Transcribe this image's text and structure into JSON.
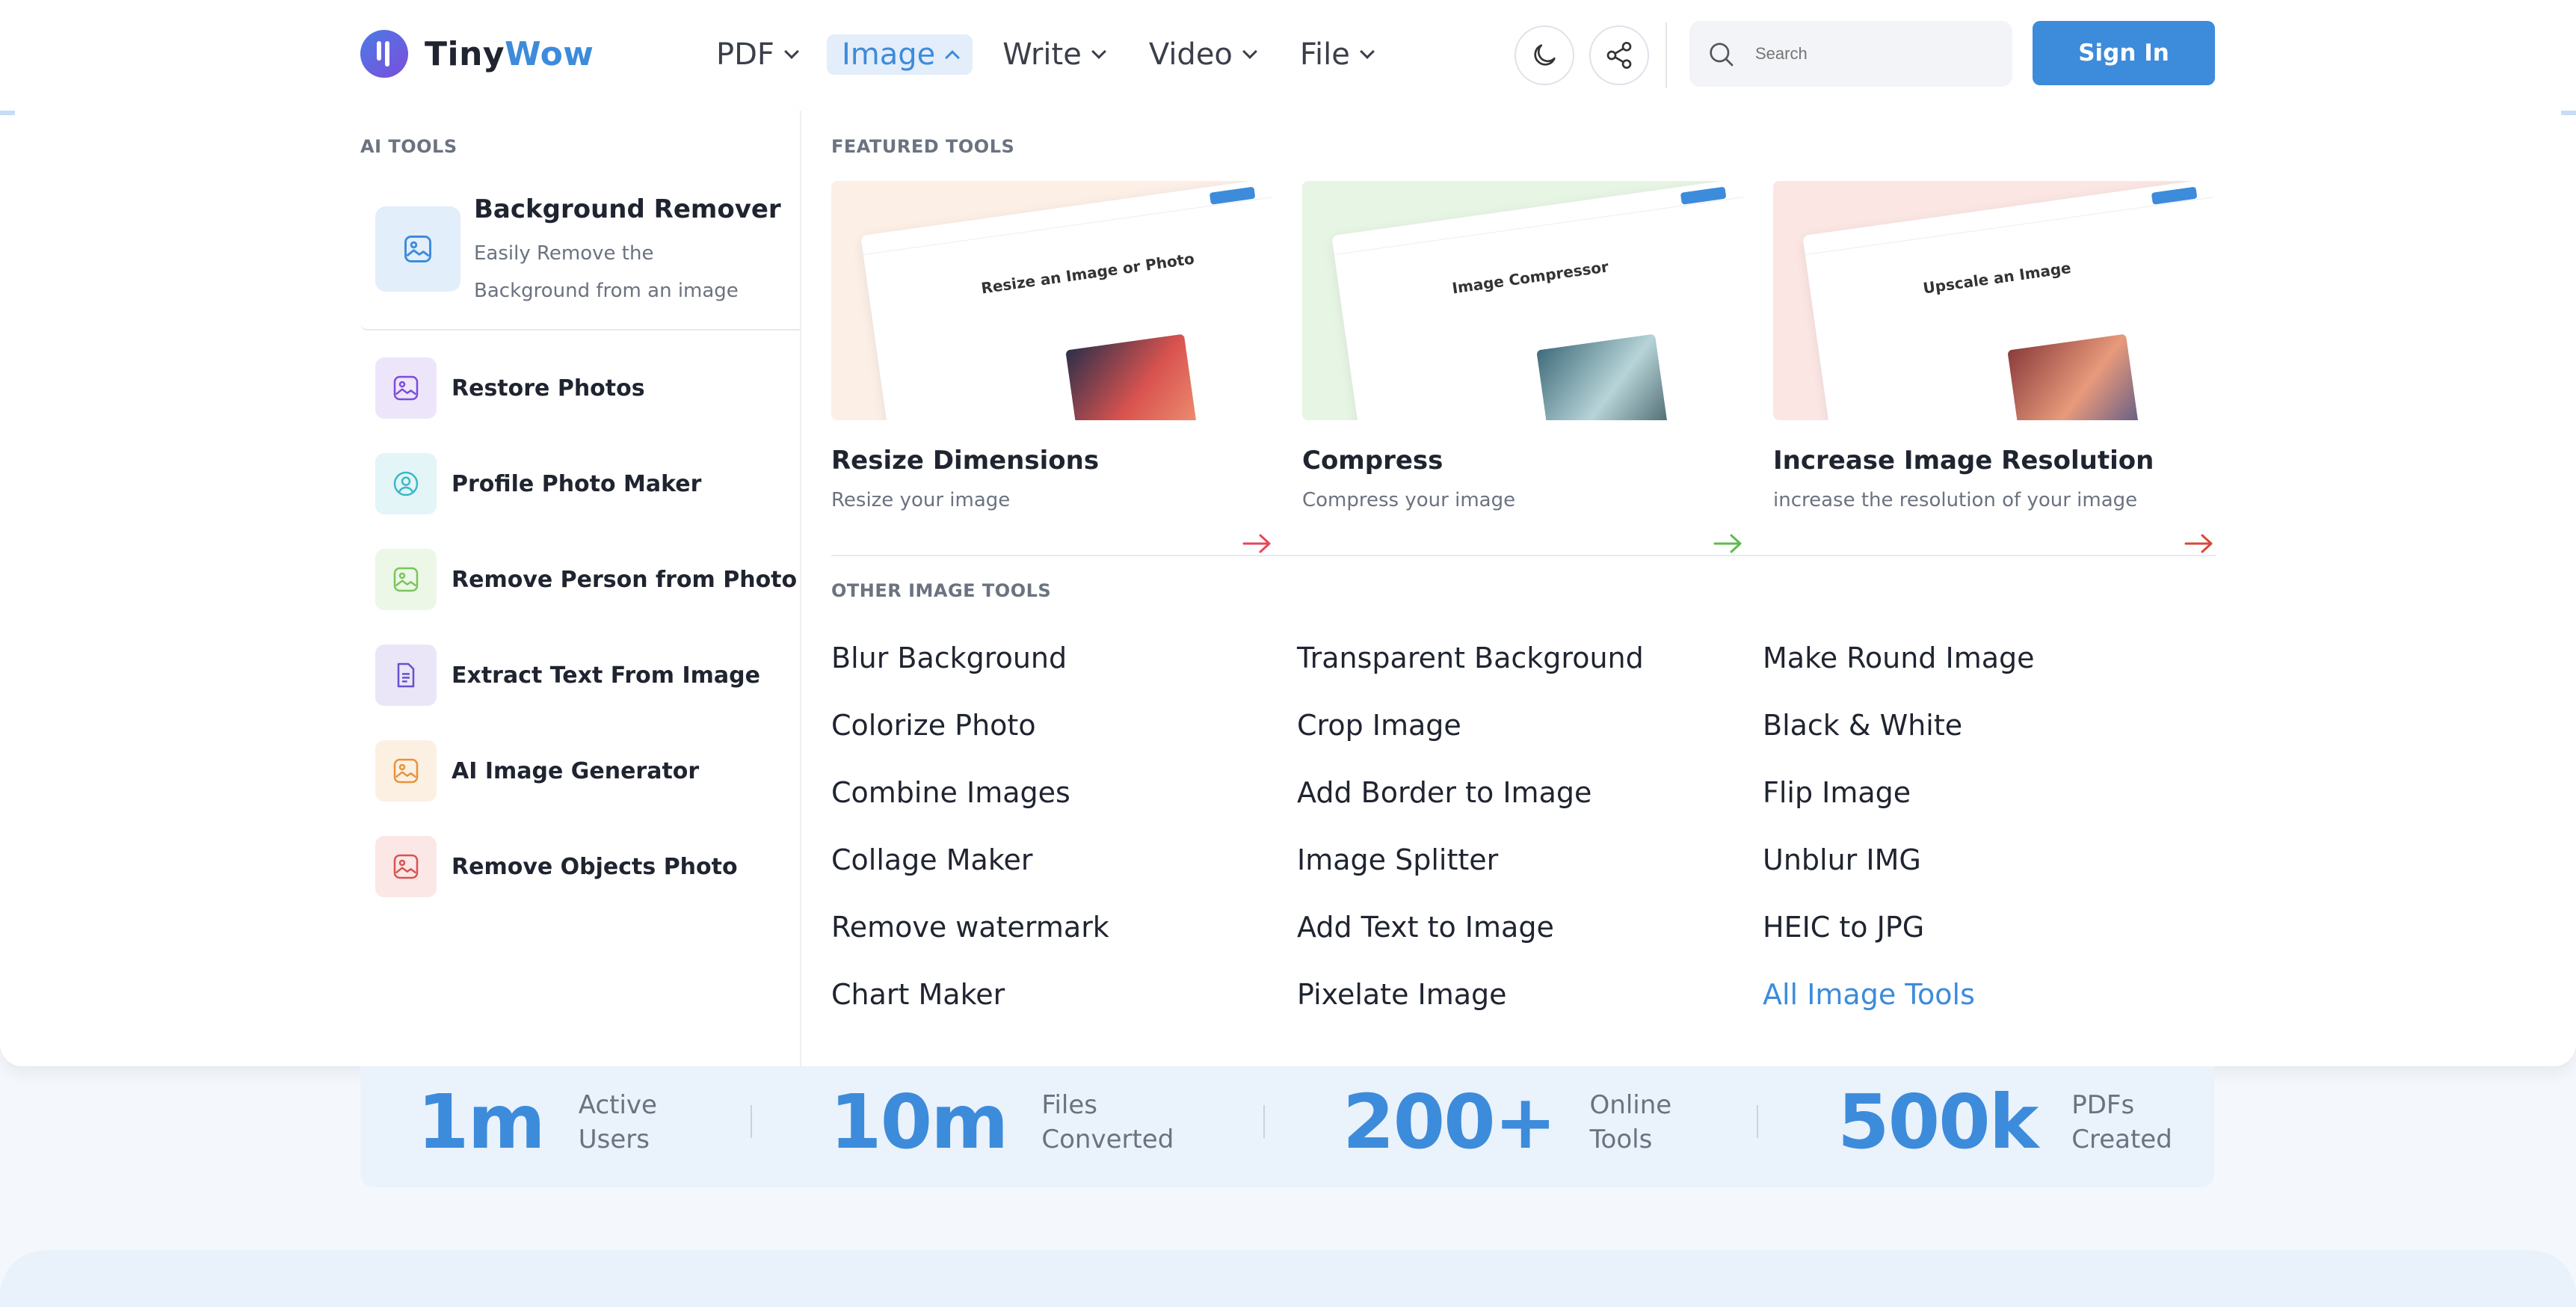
{
  "header": {
    "logo": {
      "part1": "Tiny",
      "part2": "Wow"
    },
    "nav": [
      {
        "label": "PDF"
      },
      {
        "label": "Image"
      },
      {
        "label": "Write"
      },
      {
        "label": "Video"
      },
      {
        "label": "File"
      }
    ],
    "search_placeholder": "Search",
    "signin_label": "Sign In",
    "icons": {
      "theme": "moon-icon",
      "share": "share-icon",
      "search": "search-icon"
    },
    "accent_color": "#3d8bdb"
  },
  "dropdown": {
    "ai_tools_label": "AI TOOLS",
    "ai_feature": {
      "title": "Background Remover",
      "desc_line1": "Easily Remove the",
      "desc_line2": "Background from an image"
    },
    "ai_items": [
      {
        "label": "Restore Photos",
        "icon": "image-icon",
        "color": "#7c4ddb"
      },
      {
        "label": "Profile Photo Maker",
        "icon": "user-icon",
        "color": "#3bb8c6"
      },
      {
        "label": "Remove Person from Photo",
        "icon": "image-icon",
        "color": "#7ac55a"
      },
      {
        "label": "Extract Text From Image",
        "icon": "document-icon",
        "color": "#6b4fcf"
      },
      {
        "label": "AI Image Generator",
        "icon": "image-icon",
        "color": "#e8923a"
      },
      {
        "label": "Remove Objects Photo",
        "icon": "image-icon",
        "color": "#d9534f"
      }
    ],
    "featured_label": "FEATURED TOOLS",
    "featured": [
      {
        "title": "Resize Dimensions",
        "desc": "Resize your image",
        "mock_title": "Resize an Image or Photo",
        "color": "#e8455a"
      },
      {
        "title": "Compress",
        "desc": "Compress your image",
        "mock_title": "Image Compressor",
        "color": "#5cbd4b"
      },
      {
        "title": "Increase Image Resolution",
        "desc": "increase the resolution of your image",
        "mock_title": "Upscale an Image",
        "color": "#d44b3a"
      }
    ],
    "other_label": "OTHER IMAGE TOOLS",
    "other_tools": [
      [
        "Blur Background",
        "Transparent Background",
        "Make Round Image"
      ],
      [
        "Colorize Photo",
        "Crop Image",
        "Black & White"
      ],
      [
        "Combine Images",
        "Add Border to Image",
        "Flip Image"
      ],
      [
        "Collage Maker",
        "Image Splitter",
        "Unblur IMG"
      ],
      [
        "Remove watermark",
        "Add Text to Image",
        "HEIC to JPG"
      ],
      [
        "Chart Maker",
        "Pixelate Image",
        "All Image Tools"
      ]
    ]
  },
  "stats": [
    {
      "value": "1m",
      "line1": "Active",
      "line2": "Users"
    },
    {
      "value": "10m",
      "line1": "Files",
      "line2": "Converted"
    },
    {
      "value": "200+",
      "line1": "Online",
      "line2": "Tools"
    },
    {
      "value": "500k",
      "line1": "PDFs",
      "line2": "Created"
    }
  ]
}
